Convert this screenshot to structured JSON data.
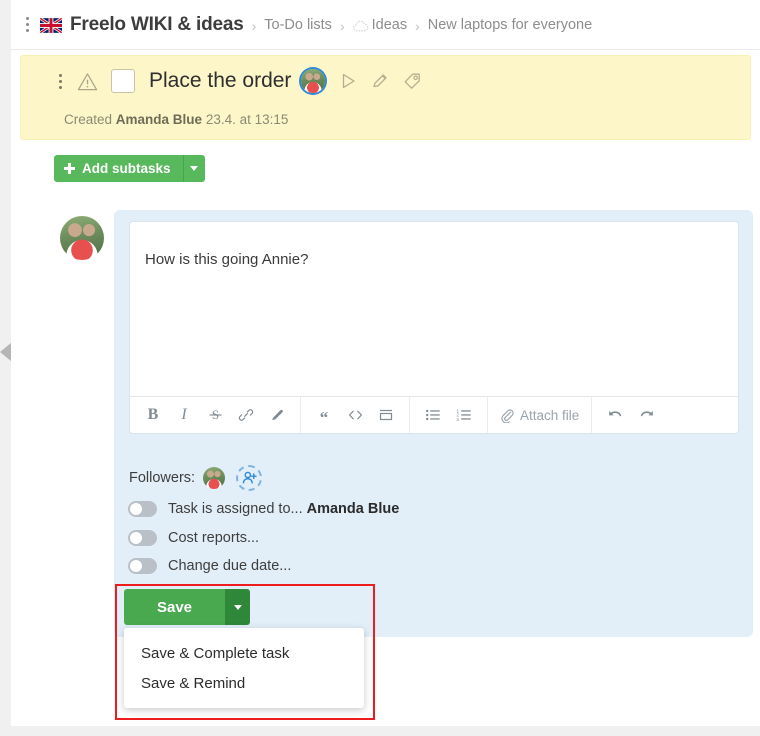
{
  "breadcrumb": {
    "kebab_icon": "kebab-menu-icon",
    "flag": "🇬🇧",
    "project": "Freelo WIKI & ideas",
    "sep": "›",
    "items": [
      {
        "label": "To-Do lists",
        "icon": null
      },
      {
        "label": "Ideas",
        "icon": "cloud-icon"
      },
      {
        "label": "New laptops for everyone",
        "icon": null
      }
    ]
  },
  "task": {
    "kebab_icon": "kebab-menu-icon",
    "warning_icon": "warning-triangle-icon",
    "checkbox_checked": false,
    "title": "Place the order",
    "assignee_avatar": "amanda-blue-avatar",
    "icons": [
      "play-timer-icon",
      "edit-pencil-icon",
      "tag-icon"
    ],
    "created_prefix": "Created",
    "created_author": "Amanda Blue",
    "created_date": "23.4. at 13:15"
  },
  "subtasks": {
    "add_label": "Add subtasks",
    "plus_icon": "plus-icon",
    "caret_icon": "chevron-down-icon"
  },
  "comment": {
    "author_avatar": "current-user-avatar",
    "text": "How is this going Annie?",
    "toolbar": {
      "groups": [
        [
          {
            "name": "bold-icon",
            "glyph": "B"
          },
          {
            "name": "italic-icon",
            "glyph": "I"
          },
          {
            "name": "strikethrough-icon",
            "glyph": "S"
          },
          {
            "name": "link-icon",
            "glyph": "link"
          },
          {
            "name": "highlighter-icon",
            "glyph": "brush"
          }
        ],
        [
          {
            "name": "quote-icon",
            "glyph": "“"
          },
          {
            "name": "code-icon",
            "glyph": "<>"
          },
          {
            "name": "block-icon",
            "glyph": "block"
          }
        ],
        [
          {
            "name": "bullet-list-icon",
            "glyph": "ul"
          },
          {
            "name": "numbered-list-icon",
            "glyph": "ol"
          }
        ],
        [
          {
            "name": "attach-file-button",
            "glyph": "paperclip",
            "label": "Attach file"
          }
        ],
        [
          {
            "name": "undo-icon",
            "glyph": "undo"
          },
          {
            "name": "redo-icon",
            "glyph": "redo"
          }
        ]
      ],
      "attach_label": "Attach file"
    }
  },
  "followers": {
    "label": "Followers:",
    "avatars": [
      "amanda-blue-avatar"
    ],
    "add_icon": "add-person-icon"
  },
  "toggles": [
    {
      "name": "task-assigned-to",
      "label": "Task is assigned to...",
      "value": "Amanda Blue",
      "on": false
    },
    {
      "name": "cost-reports",
      "label": "Cost reports...",
      "value": "",
      "on": false
    },
    {
      "name": "change-due-date",
      "label": "Change due date...",
      "value": "",
      "on": false
    }
  ],
  "save": {
    "label": "Save",
    "caret_icon": "chevron-down-icon",
    "menu": [
      {
        "label": "Save & Complete task"
      },
      {
        "label": "Save & Remind"
      }
    ]
  },
  "collapse": {
    "icon": "collapse-left-arrow-icon"
  },
  "colors": {
    "green": "#48a94f",
    "green_dark": "#2f8739",
    "green_light": "#58b85c",
    "yellow": "#fcf6c8",
    "panel_blue": "#e2eff9",
    "accent_blue": "#2e8ad6",
    "annotation_red": "#ee1c1c",
    "text": "#3a3a3a",
    "muted": "#8d8d8d"
  }
}
